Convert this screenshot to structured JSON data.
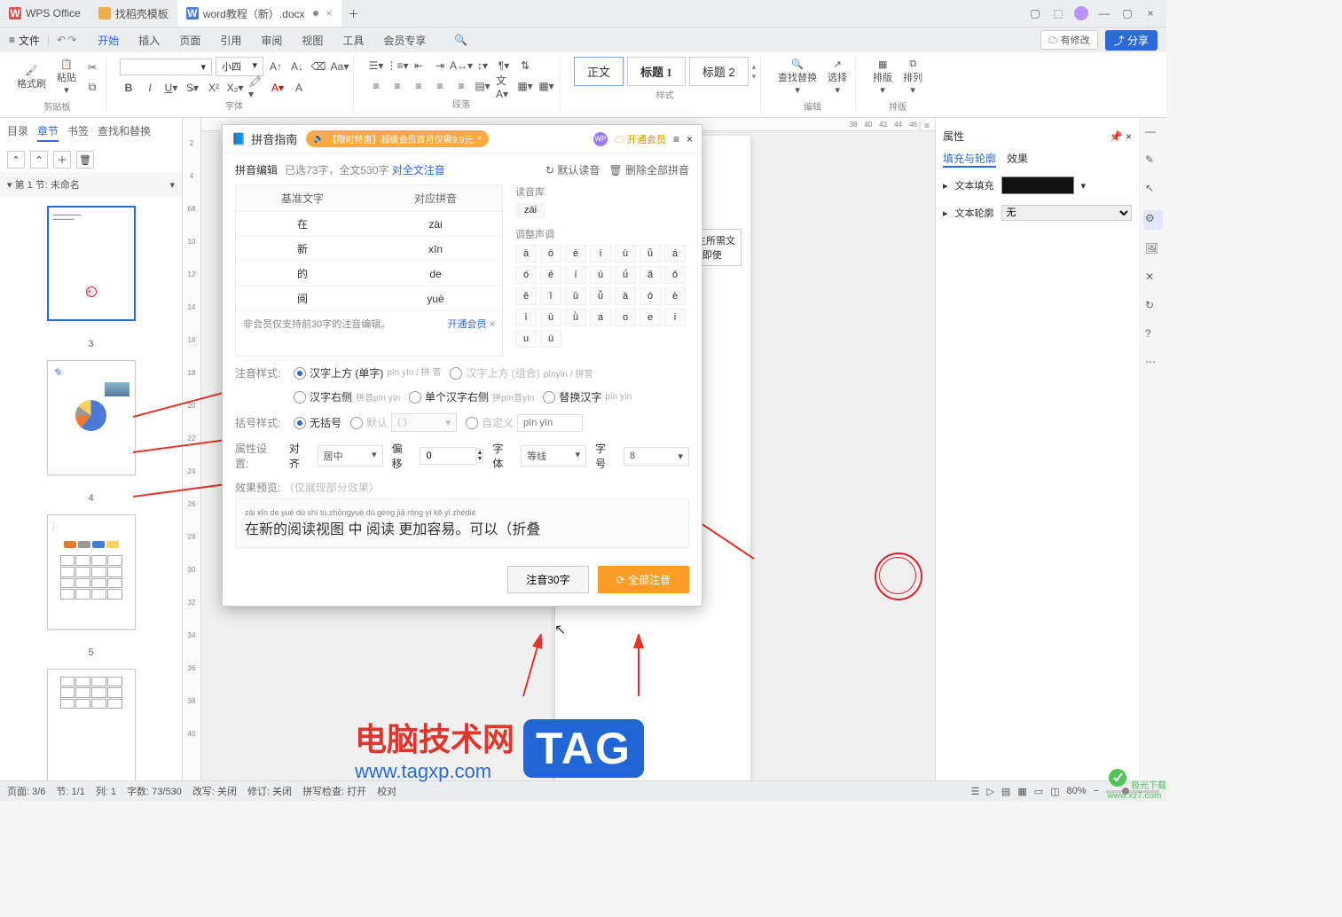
{
  "titlebar": {
    "tabs": [
      {
        "icon": "W",
        "label": "WPS Office"
      },
      {
        "icon": "orange",
        "label": "找稻壳模板"
      },
      {
        "icon": "W-blue",
        "label": "word教程（新）.docx"
      }
    ]
  },
  "menu": {
    "file": "文件",
    "items": [
      "开始",
      "插入",
      "页面",
      "引用",
      "审阅",
      "视图",
      "工具",
      "会员专享"
    ],
    "edit_status": "有修改",
    "share": "分享"
  },
  "ribbon": {
    "clip": {
      "format_brush": "格式刷",
      "paste": "粘贴",
      "label": "剪贴板"
    },
    "font": {
      "name": "",
      "size": "小四",
      "label": "字体"
    },
    "para": {
      "label": "段落"
    },
    "styles": {
      "items": [
        "正文",
        "标题 1",
        "标题 2"
      ],
      "label": "样式"
    },
    "edit": {
      "find": "查找替换",
      "select": "选择",
      "label": "编辑"
    },
    "arrange": {
      "layout": "排版",
      "align": "排列",
      "label": "排版"
    }
  },
  "sidebar": {
    "tabs": [
      "目录",
      "章节",
      "书签",
      "查找和替换"
    ],
    "active": 1,
    "section_header": "第 1 节: 未命名",
    "thumbs": [
      {
        "n": "3"
      },
      {
        "n": "4"
      },
      {
        "n": "5"
      },
      {
        "n": ""
      }
    ]
  },
  "ruler_h": [
    "38",
    "40",
    "42",
    "44",
    "46"
  ],
  "ruler_v": [
    "2",
    "4",
    "68",
    "10",
    "12",
    "14",
    "16",
    "18",
    "20",
    "22",
    "24",
    "26",
    "28",
    "30",
    "32",
    "34",
    "36",
    "38",
    "40"
  ],
  "doc_text": {
    "l1": "主所需文",
    "l2": "- 即使"
  },
  "props": {
    "title": "属性",
    "tabs": [
      "填充与轮廓",
      "效果"
    ],
    "fill_label": "文本填充",
    "outline_label": "文本轮廓",
    "outline_val": "无"
  },
  "dialog": {
    "title": "拼音指南",
    "promo": "【限时特惠】超级会员首月仅需9.9元",
    "vip": "开通会员",
    "editor": {
      "label": "拼音编辑",
      "info_prefix": "已选73字，全文530字",
      "full_link": "对全文注音",
      "default": "默认读音",
      "delete": "删除全部拼音"
    },
    "table": {
      "h1": "基准文字",
      "h2": "对应拼音",
      "rows": [
        [
          "在",
          "zài"
        ],
        [
          "新",
          "xīn"
        ],
        [
          "的",
          "de"
        ],
        [
          "阅",
          "yuè"
        ]
      ],
      "notice": "非会员仅支持前30字的注音编辑。",
      "notice_link": "开通会员"
    },
    "readlib": {
      "label": "读音库",
      "val": "zài"
    },
    "tone": {
      "label": "调整声调",
      "vals": [
        "ā",
        "ō",
        "ē",
        "ī",
        "ū",
        "ǖ",
        "á",
        "ó",
        "é",
        "í",
        "ú",
        "ǘ",
        "ǎ",
        "ǒ",
        "ě",
        "ǐ",
        "ǔ",
        "ǚ",
        "à",
        "ò",
        "è",
        "ì",
        "ù",
        "ǜ",
        "a",
        "o",
        "e",
        "i",
        "u",
        "ü"
      ]
    },
    "style": {
      "label": "注音样式:",
      "opts": [
        {
          "label": "汉字上方 (单字)",
          "sub": "pīn yīn / 拼 音",
          "sel": true
        },
        {
          "label": "汉字上方 (组合)",
          "sub": "pīnyīn / 拼音",
          "dis": true
        },
        {
          "label": "汉字右侧",
          "sub": "拼音pīn yīn"
        },
        {
          "label": "单个汉字右侧",
          "sub": "拼pīn音yīn"
        },
        {
          "label": "替换汉字",
          "sub": "pīn yīn"
        }
      ]
    },
    "bracket": {
      "label": "括号样式:",
      "opts": [
        {
          "label": "无括号",
          "sel": true
        },
        {
          "label": "默认",
          "sel_val": "( )",
          "dis": true
        },
        {
          "label": "自定义",
          "placeholder": "pīn yīn",
          "dis": true
        }
      ]
    },
    "attr": {
      "label": "属性设置:",
      "align_l": "对齐",
      "align_v": "居中",
      "offset_l": "偏移",
      "offset_v": "0",
      "font_l": "字体",
      "font_v": "等线",
      "size_l": "字号",
      "size_v": "8"
    },
    "preview": {
      "label": "效果预览:",
      "note": "（仅展现部分效果）",
      "pinyin": "zài xīn de yuè dú shì tú zhōngyuè dú gèng jiā róng yì    kě  yǐ     zhédié",
      "hanzi": "在新的阅读视图 中 阅读 更加容易。可以（折叠"
    },
    "btn_lite": "注音30字",
    "btn_full": "全部注音"
  },
  "status": {
    "page": "页面: 3/6",
    "section": "节: 1/1",
    "col": "列: 1",
    "words": "字数: 73/530",
    "rev": "改写: 关闭",
    "track": "修订: 关闭",
    "spell": "拼写检查: 打开",
    "proof": "校对",
    "zoom": "80%"
  },
  "wm": {
    "title": "电脑技术网",
    "url": "www.tagxp.com",
    "tag": "TAG",
    "jiguang": "极光下载",
    "jiguang_url": "www.xz7.com"
  }
}
